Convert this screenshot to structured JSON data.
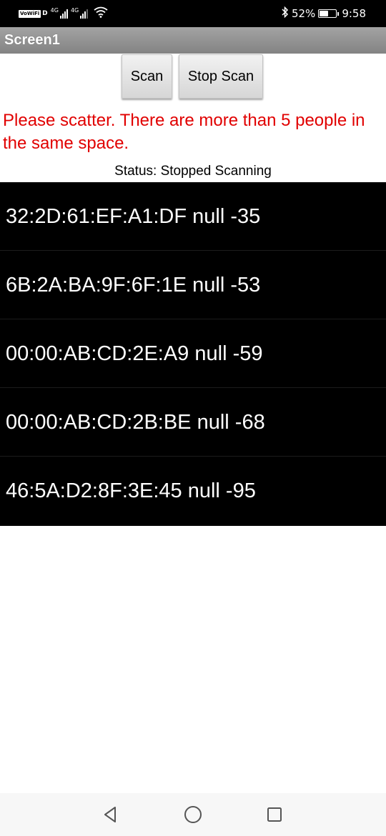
{
  "status_bar": {
    "vowifi_label": "VoWiFi",
    "vowifi_suffix": "D",
    "net1_label": "4G",
    "net2_label": "4G",
    "battery_percent": "52%",
    "battery_level": 52,
    "time": "9:58",
    "icons": [
      "vowifi-icon",
      "signal-icon",
      "signal-icon",
      "wifi-icon",
      "bluetooth-icon",
      "battery-icon"
    ]
  },
  "title_bar": {
    "title": "Screen1"
  },
  "buttons": {
    "scan_label": "Scan",
    "stop_scan_label": "Stop Scan"
  },
  "warning": {
    "text": "Please scatter. There are more than 5 people in the same space.",
    "color": "#e10000"
  },
  "status": {
    "text": "Status: Stopped Scanning"
  },
  "devices": [
    "32:2D:61:EF:A1:DF null -35",
    "6B:2A:BA:9F:6F:1E null -53",
    "00:00:AB:CD:2E:A9 null -59",
    "00:00:AB:CD:2B:BE null -68",
    "46:5A:D2:8F:3E:45 null -95"
  ],
  "nav_bar": {
    "icons": [
      "back-icon",
      "home-icon",
      "recent-apps-icon"
    ]
  }
}
